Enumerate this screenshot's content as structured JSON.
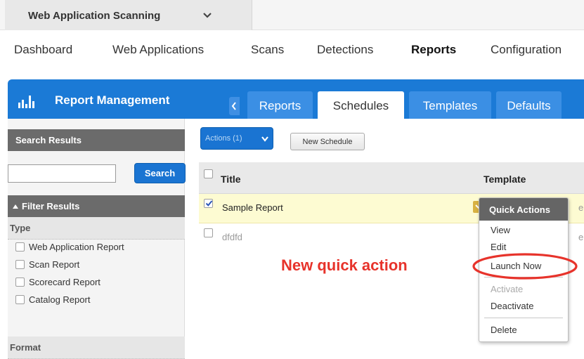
{
  "app_switcher": {
    "name": "Web Application Scanning"
  },
  "nav": {
    "items": [
      {
        "label": "Dashboard"
      },
      {
        "label": "Web Applications"
      },
      {
        "label": "Scans"
      },
      {
        "label": "Detections"
      },
      {
        "label": "Reports",
        "active": true
      },
      {
        "label": "Configuration"
      }
    ]
  },
  "module": {
    "title": "Report Management",
    "tabs": [
      {
        "label": "Reports"
      },
      {
        "label": "Schedules",
        "active": true
      },
      {
        "label": "Templates"
      },
      {
        "label": "Defaults"
      }
    ]
  },
  "sidebar": {
    "search_header": "Search Results",
    "search_value": "",
    "search_button": "Search",
    "filter_header": "Filter Results",
    "type_header": "Type",
    "type_options": [
      {
        "label": "Web Application Report",
        "checked": false
      },
      {
        "label": "Scan Report",
        "checked": false
      },
      {
        "label": "Scorecard Report",
        "checked": false
      },
      {
        "label": "Catalog Report",
        "checked": false
      }
    ],
    "format_header": "Format"
  },
  "toolbar": {
    "actions_label": "Actions (1)",
    "new_schedule_label": "New Schedule"
  },
  "table": {
    "columns": {
      "title": "Title",
      "template": "Template"
    },
    "rows": [
      {
        "title": "Sample Report",
        "selected": true,
        "template": "ep"
      },
      {
        "title": "dfdfd",
        "selected": false,
        "template": "ep"
      }
    ]
  },
  "quick_actions": {
    "header": "Quick Actions",
    "items": [
      {
        "label": "View"
      },
      {
        "label": "Edit"
      },
      {
        "label": "Launch Now"
      },
      {
        "label": "Activate",
        "disabled": true
      },
      {
        "label": "Deactivate"
      },
      {
        "label": "Delete"
      }
    ]
  },
  "annotation": {
    "text": "New quick action",
    "color": "#e7332b"
  },
  "colors": {
    "brand_blue": "#1b7ad6",
    "tab_blue": "#3b8fe4",
    "selected_row": "#fdfbd2",
    "panel_header": "#6b6b6b"
  }
}
